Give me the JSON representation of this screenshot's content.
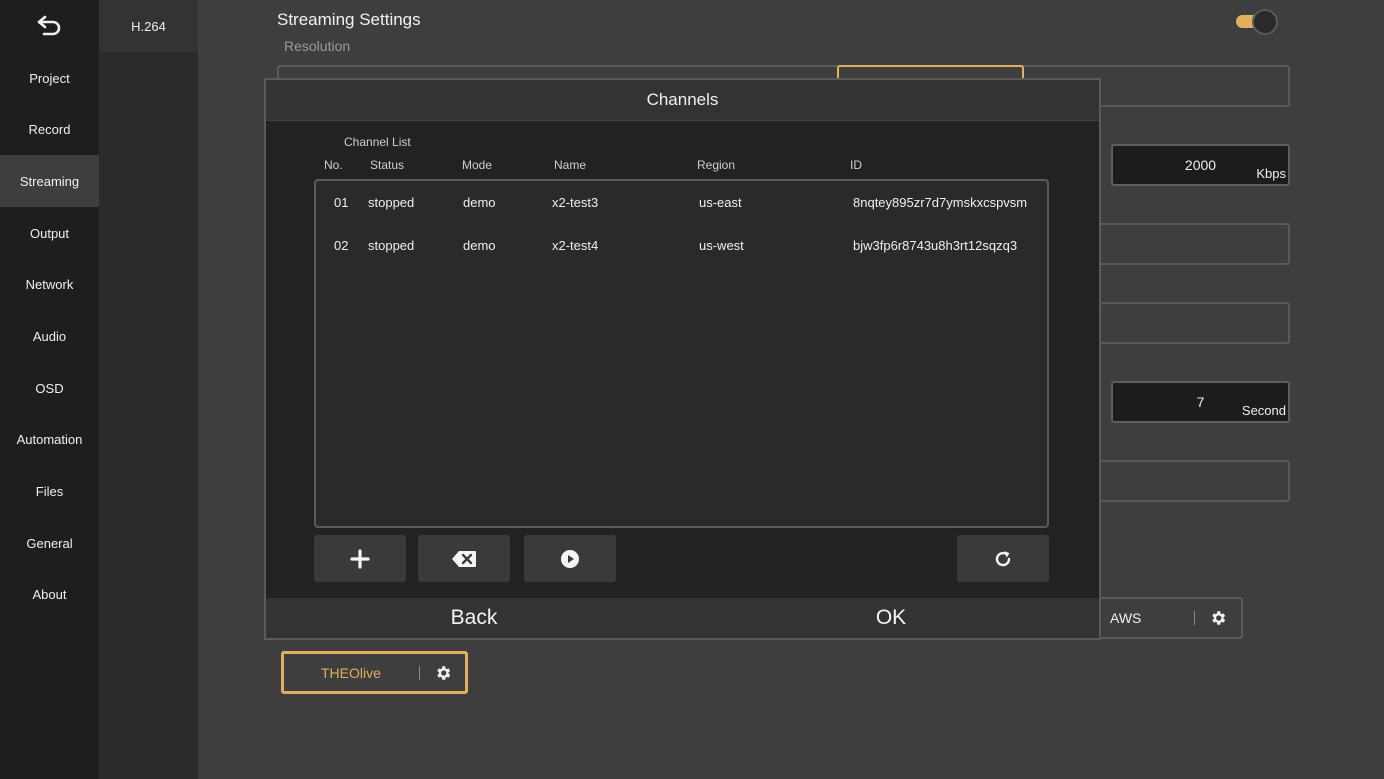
{
  "sidebar": {
    "back_icon": "back-arrow-icon",
    "items": [
      {
        "label": "Project",
        "active": false
      },
      {
        "label": "Record",
        "active": false
      },
      {
        "label": "Streaming",
        "active": true
      },
      {
        "label": "Output",
        "active": false
      },
      {
        "label": "Network",
        "active": false
      },
      {
        "label": "Audio",
        "active": false
      },
      {
        "label": "OSD",
        "active": false
      },
      {
        "label": "Automation",
        "active": false
      },
      {
        "label": "Files",
        "active": false
      },
      {
        "label": "General",
        "active": false
      },
      {
        "label": "About",
        "active": false
      }
    ]
  },
  "subnav": {
    "codec": "H.264"
  },
  "main": {
    "title": "Streaming Settings",
    "resolution_label": "Resolution",
    "streaming_enabled": true,
    "bitrate": {
      "value": "2000",
      "unit": "Kbps"
    },
    "interval": {
      "value": "7",
      "unit": "Second"
    },
    "services": {
      "aws": "AWS",
      "theolive": "THEOlive"
    }
  },
  "dialog": {
    "title": "Channels",
    "list_title": "Channel List",
    "columns": {
      "no": "No.",
      "status": "Status",
      "mode": "Mode",
      "name": "Name",
      "region": "Region",
      "id": "ID"
    },
    "rows": [
      {
        "no": "01",
        "status": "stopped",
        "mode": "demo",
        "name": "x2-test3",
        "region": "us-east",
        "id": "8nqtey895zr7d7ymskxcspvsm"
      },
      {
        "no": "02",
        "status": "stopped",
        "mode": "demo",
        "name": "x2-test4",
        "region": "us-west",
        "id": "bjw3fp6r8743u8h3rt12sqzq3"
      }
    ],
    "tools": {
      "add": "plus-icon",
      "delete": "backspace-icon",
      "start": "play-icon",
      "refresh": "refresh-icon"
    },
    "back_label": "Back",
    "ok_label": "OK"
  },
  "colors": {
    "accent": "#e0b060",
    "sidebar_bg": "#1e1e1e",
    "main_bg": "#3e3e3e",
    "dialog_bg": "#222222"
  }
}
